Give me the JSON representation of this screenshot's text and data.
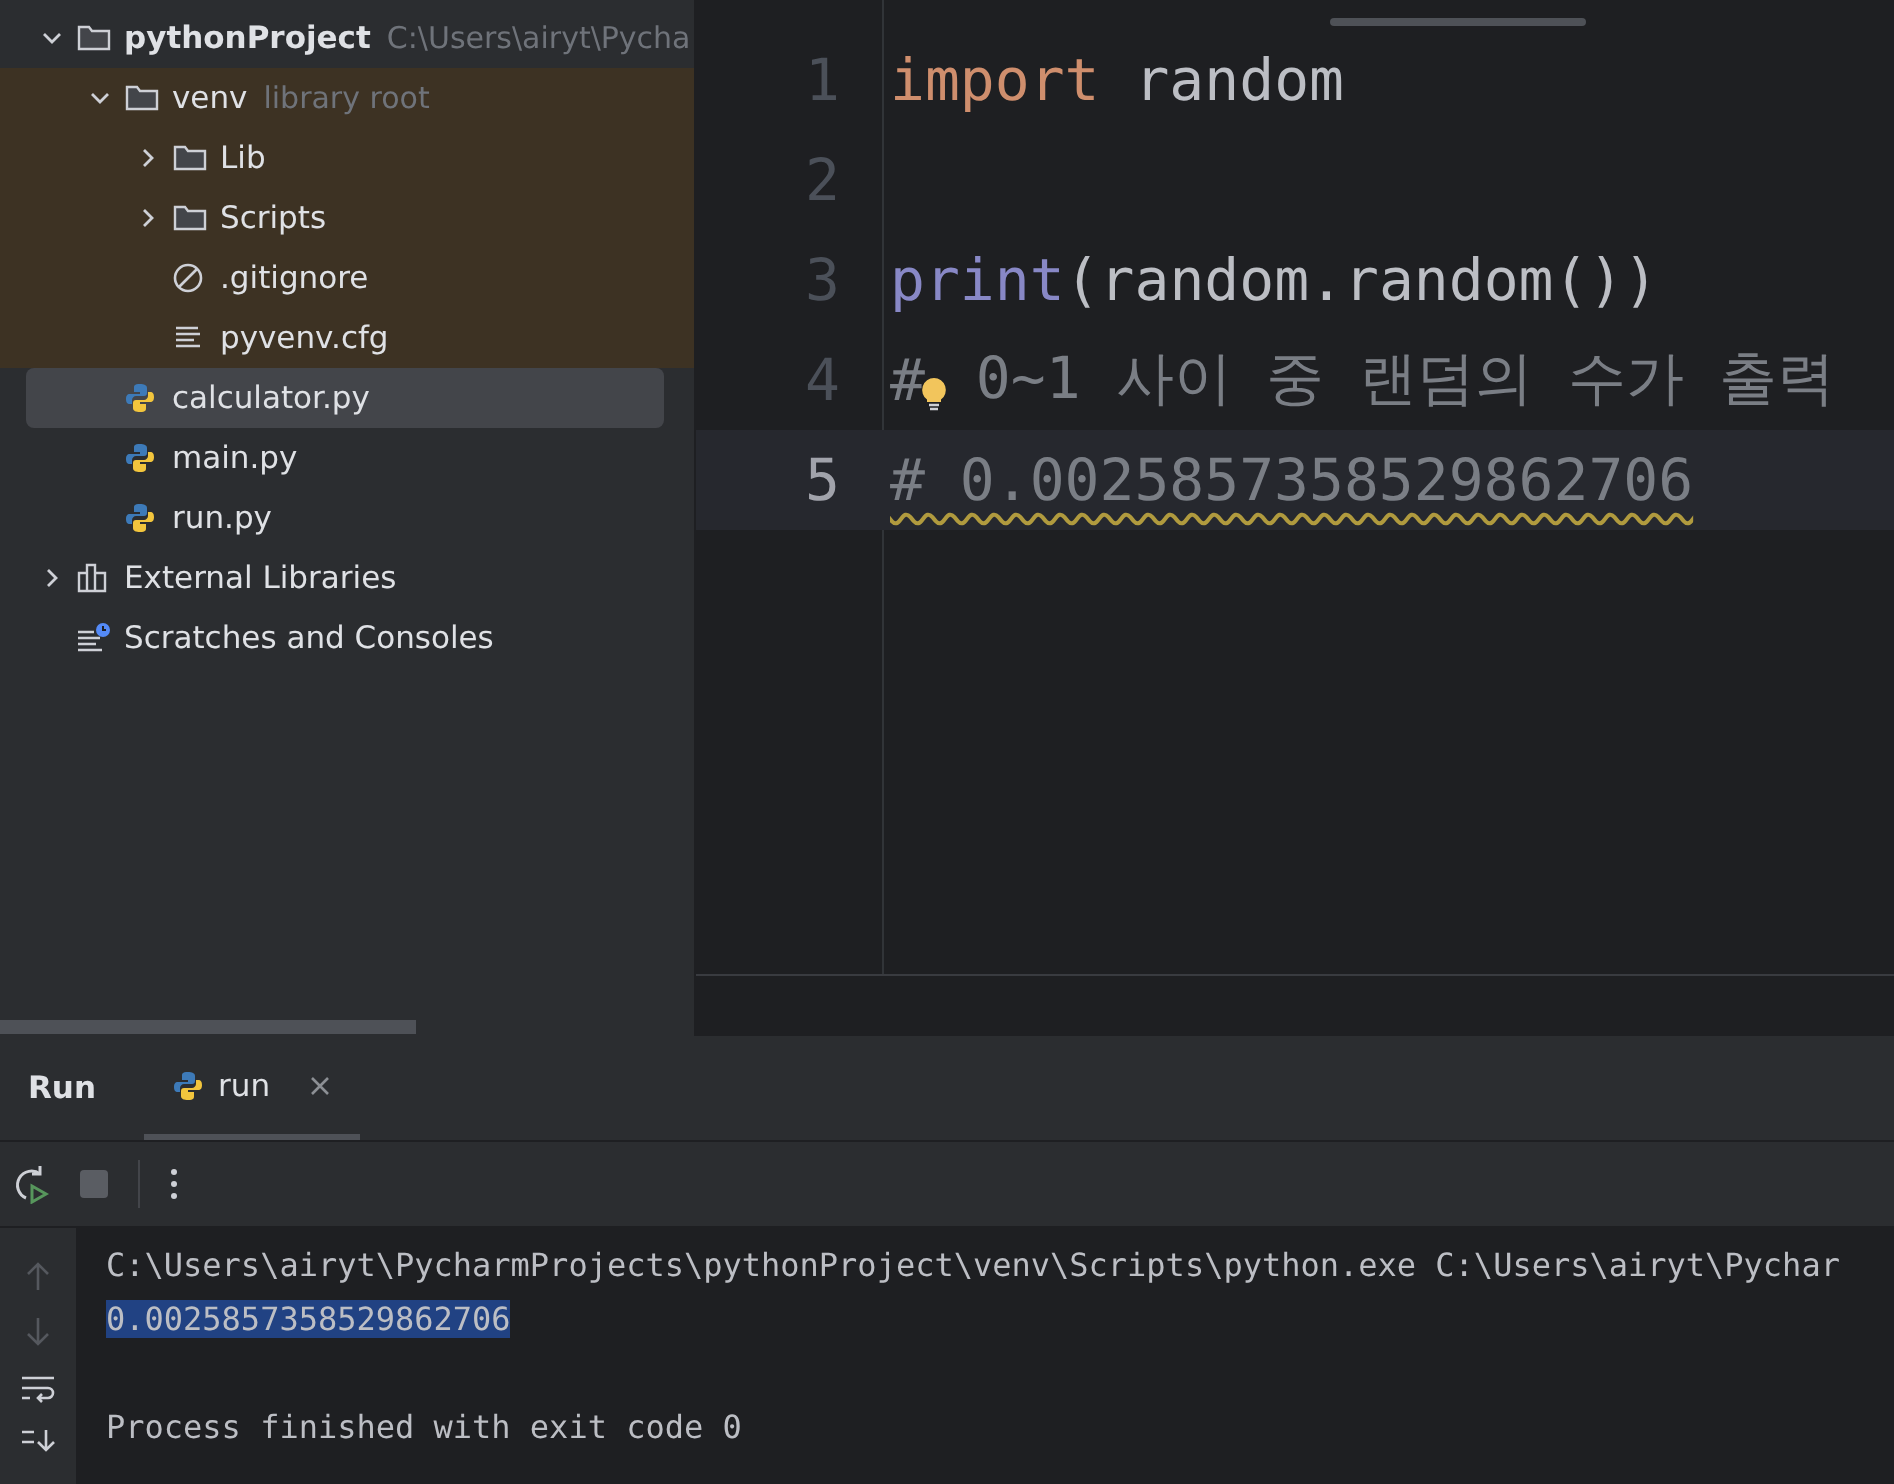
{
  "project_tree": [
    {
      "label": "pythonProject",
      "hint": "C:\\Users\\airyt\\Pycha",
      "kind": "folder",
      "bold": true,
      "expanded": true,
      "selected": false,
      "children": [
        {
          "label": "venv",
          "hint": "library root",
          "kind": "folder",
          "library": true,
          "expanded": true,
          "selected": false,
          "children": [
            {
              "label": "Lib",
              "kind": "folder",
              "expanded": false,
              "selected": false
            },
            {
              "label": "Scripts",
              "kind": "folder",
              "expanded": false,
              "selected": false
            },
            {
              "label": ".gitignore",
              "kind": "ignore",
              "selected": false
            },
            {
              "label": "pyvenv.cfg",
              "kind": "text",
              "selected": false
            }
          ]
        },
        {
          "label": "calculator.py",
          "kind": "python",
          "selected": true
        },
        {
          "label": "main.py",
          "kind": "python",
          "selected": false
        },
        {
          "label": "run.py",
          "kind": "python",
          "selected": false
        }
      ]
    },
    {
      "label": "External Libraries",
      "kind": "library",
      "expanded": false,
      "selected": false
    },
    {
      "label": "Scratches and Consoles",
      "kind": "scratches",
      "selected": false
    }
  ],
  "editor": {
    "lines": [
      {
        "number": "1",
        "current": false,
        "tokens": [
          {
            "text": "import",
            "kind": "keyword"
          },
          {
            "text": " random",
            "kind": "plain"
          }
        ]
      },
      {
        "number": "2",
        "current": false
      },
      {
        "number": "3",
        "current": false,
        "tokens": [
          {
            "text": "print",
            "kind": "builtin"
          },
          {
            "text": "(random.random())",
            "kind": "plain"
          }
        ]
      },
      {
        "number": "4",
        "current": false,
        "bulb": true,
        "tokens": [
          {
            "text": "#",
            "kind": "comment"
          },
          {
            "text": " 0~1 사이 중 랜덤의 수가 출력",
            "kind": "comment"
          }
        ]
      },
      {
        "number": "5",
        "current": true,
        "tokens": [
          {
            "text": "# 0.0025857358529862706",
            "kind": "comment",
            "warning": true
          }
        ]
      }
    ]
  },
  "run_panel": {
    "title": "Run",
    "tabs": [
      {
        "label": "run",
        "selected": true
      }
    ],
    "console": [
      {
        "text": "C:\\Users\\airyt\\PycharmProjects\\pythonProject\\venv\\Scripts\\python.exe C:\\Users\\airyt\\Pychar",
        "kind": "command",
        "selected": false
      },
      {
        "text": "0.0025857358529862706",
        "kind": "output",
        "selected": true
      },
      {
        "text": "Process finished with exit code 0",
        "kind": "exit",
        "selected": false
      }
    ]
  }
}
